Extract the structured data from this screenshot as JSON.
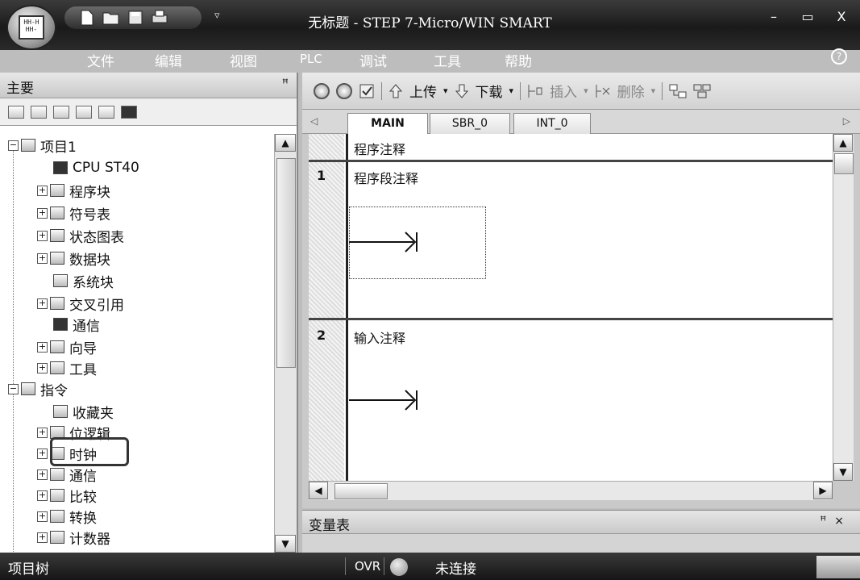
{
  "window": {
    "title": "无标题 - STEP 7-Micro/WIN SMART",
    "minimize": "–",
    "maximize": "▭",
    "close": "X"
  },
  "qat": {
    "dropdown": "▿"
  },
  "menu": {
    "items": [
      "文件",
      "编辑",
      "视图",
      "PLC",
      "调试",
      "工具",
      "帮助"
    ],
    "help": "?"
  },
  "left_panel": {
    "title": "主要",
    "pin": "ꟸ",
    "tree": [
      {
        "label": "项目1",
        "expander": "−",
        "level": 0
      },
      {
        "label": "CPU ST40",
        "expander": "",
        "level": 1
      },
      {
        "label": "程序块",
        "expander": "+",
        "level": 1
      },
      {
        "label": "符号表",
        "expander": "+",
        "level": 1
      },
      {
        "label": "状态图表",
        "expander": "+",
        "level": 1
      },
      {
        "label": "数据块",
        "expander": "+",
        "level": 1
      },
      {
        "label": "系统块",
        "expander": "",
        "level": 1
      },
      {
        "label": "交叉引用",
        "expander": "+",
        "level": 1
      },
      {
        "label": "通信",
        "expander": "",
        "level": 1
      },
      {
        "label": "向导",
        "expander": "+",
        "level": 1
      },
      {
        "label": "工具",
        "expander": "+",
        "level": 1
      },
      {
        "label": "指令",
        "expander": "−",
        "level": 0
      },
      {
        "label": "收藏夹",
        "expander": "",
        "level": 1
      },
      {
        "label": "位逻辑",
        "expander": "+",
        "level": 1
      },
      {
        "label": "时钟",
        "expander": "+",
        "level": 1
      },
      {
        "label": "通信",
        "expander": "+",
        "level": 1
      },
      {
        "label": "比较",
        "expander": "+",
        "level": 1
      },
      {
        "label": "转换",
        "expander": "+",
        "level": 1
      },
      {
        "label": "计数器",
        "expander": "+",
        "level": 1
      }
    ]
  },
  "editor": {
    "toolbar": {
      "upload": "上传",
      "download": "下载",
      "insert": "插入",
      "delete": "删除"
    },
    "tabs": [
      "MAIN",
      "SBR_0",
      "INT_0"
    ],
    "program_comment": "程序注释",
    "networks": [
      {
        "num": "1",
        "comment": "程序段注释"
      },
      {
        "num": "2",
        "comment": "输入注释"
      }
    ]
  },
  "var_panel": {
    "title": "变量表",
    "pin": "ꟸ",
    "close": "×"
  },
  "status": {
    "left": "项目树",
    "ovr": "OVR",
    "connection": "未连接"
  }
}
